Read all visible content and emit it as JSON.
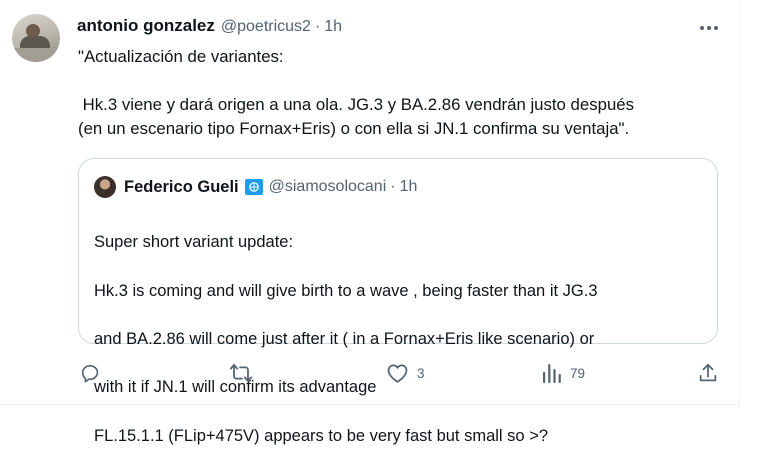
{
  "tweet": {
    "author_name": "antonio gonzalez",
    "author_handle": "@poetricus2",
    "separator": "·",
    "time": "1h",
    "text": "\"Actualización de variantes:\n\n Hk.3 viene y dará origen a una ola. JG.3 y BA.2.86 vendrán justo después\n(en un escenario tipo Fornax+Eris) o con ella si JN.1 confirma su ventaja\"."
  },
  "quote": {
    "author_name": "Federico Gueli",
    "badge_icon": "un-flag-icon",
    "author_handle": "@siamosolocani",
    "separator": "·",
    "time": "1h",
    "lines": [
      "Super short variant update:",
      "Hk.3 is coming and will give birth to a wave , being faster than it JG.3",
      "and BA.2.86 will come just after it ( in a Fornax+Eris like scenario) or",
      "with it if JN.1 will confirm its advantage",
      "FL.15.1.1 (FLip+475V) appears to be very fast but small so >?"
    ]
  },
  "actions": {
    "reply": {
      "icon": "reply-icon",
      "count": ""
    },
    "retweet": {
      "icon": "retweet-icon",
      "count": ""
    },
    "like": {
      "icon": "heart-icon",
      "count": "3"
    },
    "views": {
      "icon": "views-icon",
      "count": "79"
    },
    "share": {
      "icon": "share-icon",
      "count": ""
    }
  },
  "colors": {
    "text": "#0f1419",
    "secondary": "#536471",
    "border": "#cfd9de",
    "badge": "#1d9bf0"
  }
}
